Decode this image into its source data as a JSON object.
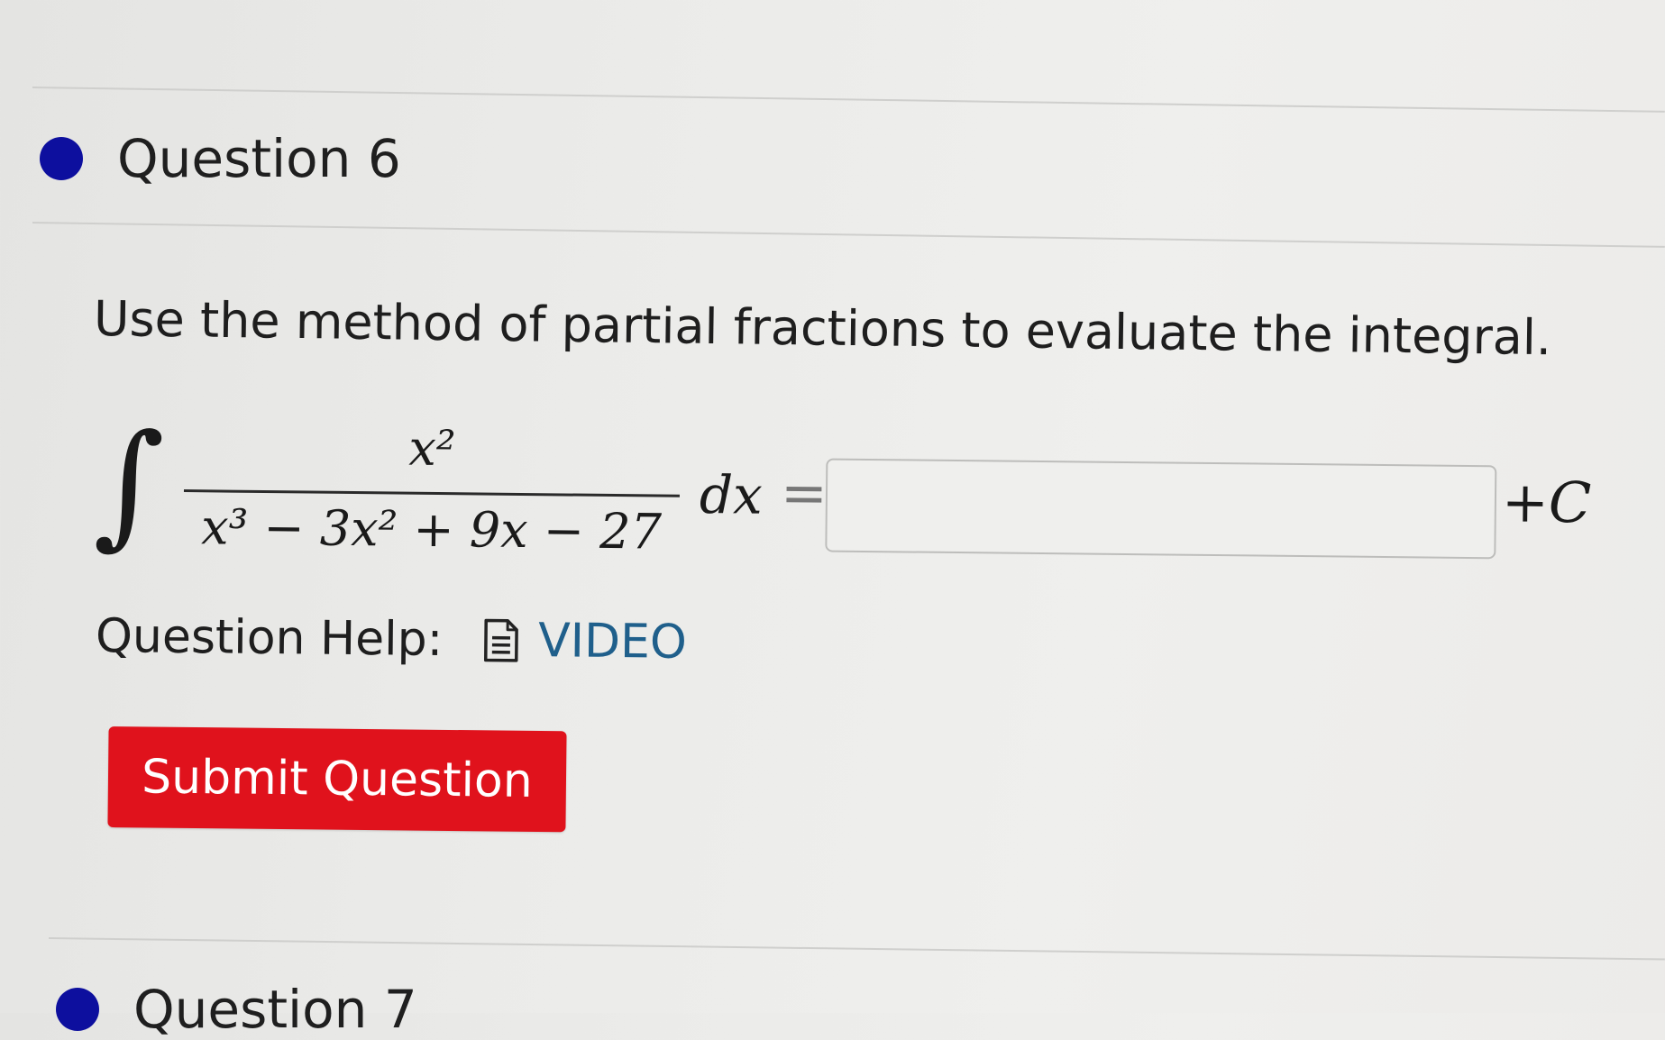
{
  "question_current": {
    "title": "Question 6",
    "prompt": "Use the method of partial fractions to evaluate the integral.",
    "integral": {
      "integral_sign": "∫",
      "numerator": "x²",
      "denominator": "x³ − 3x² + 9x − 27",
      "differential": "dx",
      "equals": "=",
      "answer_value": "",
      "constant": "+C"
    },
    "help": {
      "label": "Question Help:",
      "icon": "document-icon",
      "link_label": "VIDEO"
    },
    "submit_label": "Submit Question"
  },
  "question_next": {
    "title": "Question 7"
  },
  "colors": {
    "status_dot": "#0d0f9e",
    "submit_button": "#e0121c",
    "link": "#1f5f8b"
  }
}
